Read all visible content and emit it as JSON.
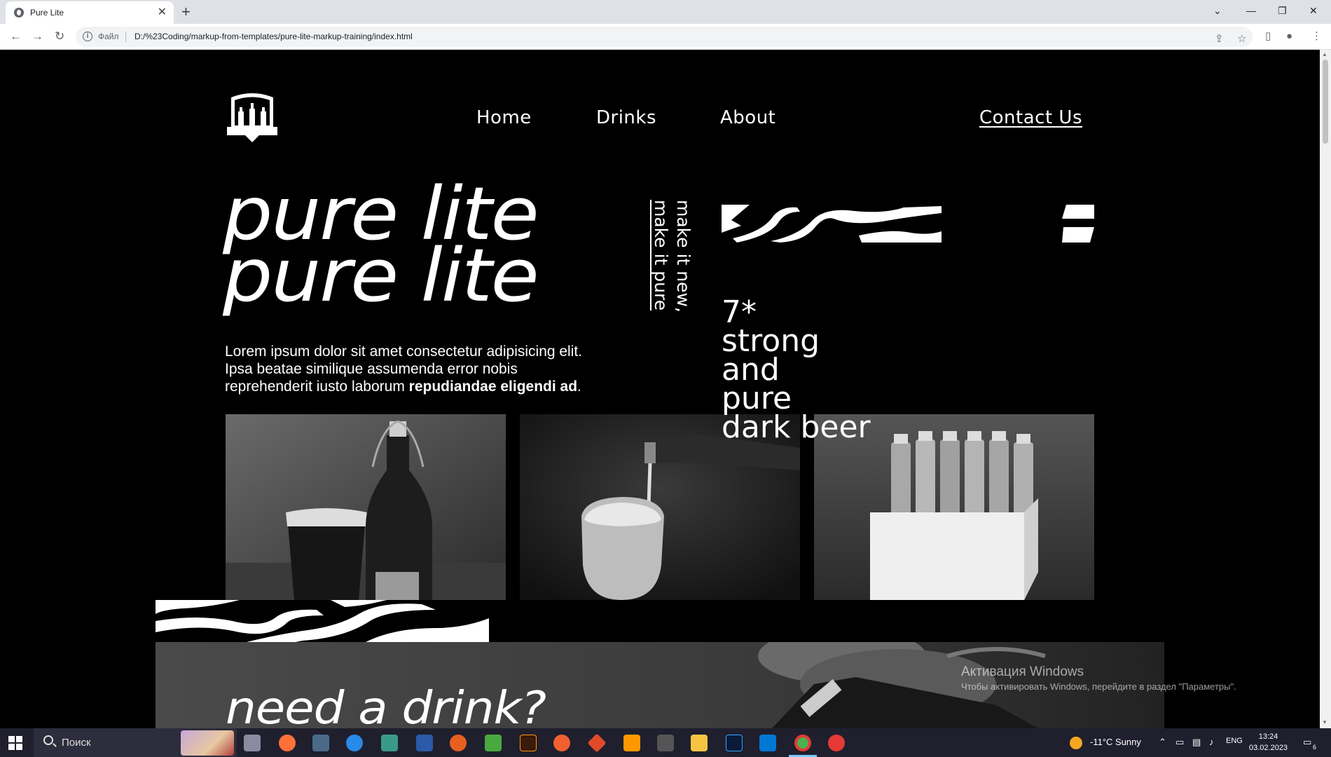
{
  "browser": {
    "tab_title": "Pure Lite",
    "new_tab": "+",
    "close_tab": "✕",
    "omnibox_label": "Файл",
    "url": "D:/%23Coding/markup-from-templates/pure-lite-markup-training/index.html"
  },
  "site": {
    "nav": [
      "Home",
      "Drinks",
      "About"
    ],
    "contact": "Contact Us",
    "hero_line_1": "pure lite",
    "hero_line_2": "pure lite",
    "vertical_a": "make it new,",
    "vertical_b": "make it pure",
    "tagline": [
      "7*",
      "strong",
      "and",
      "pure",
      "dark beer"
    ],
    "lead_plain": "Lorem ipsum dolor sit amet consectetur adipisicing elit. Ipsa beatae similique assumenda error nobis reprehenderit iusto laborum ",
    "lead_bold": "repudiandae eligendi ad",
    "lead_end": ".",
    "banner_title": "need a drink?"
  },
  "watermark": {
    "title": "Активация Windows",
    "subtitle": "Чтобы активировать Windows, перейдите в раздел \"Параметры\"."
  },
  "taskbar": {
    "search_placeholder": "Поиск",
    "weather": "-11°C  Sunny",
    "language": "ENG",
    "time": "13:24",
    "date": "03.02.2023",
    "notifications": "6"
  },
  "colors": {
    "page_bg": "#000000",
    "text": "#ffffff",
    "chrome_bg": "#dee1e6",
    "taskbar_bg": "#1f1f2e"
  }
}
